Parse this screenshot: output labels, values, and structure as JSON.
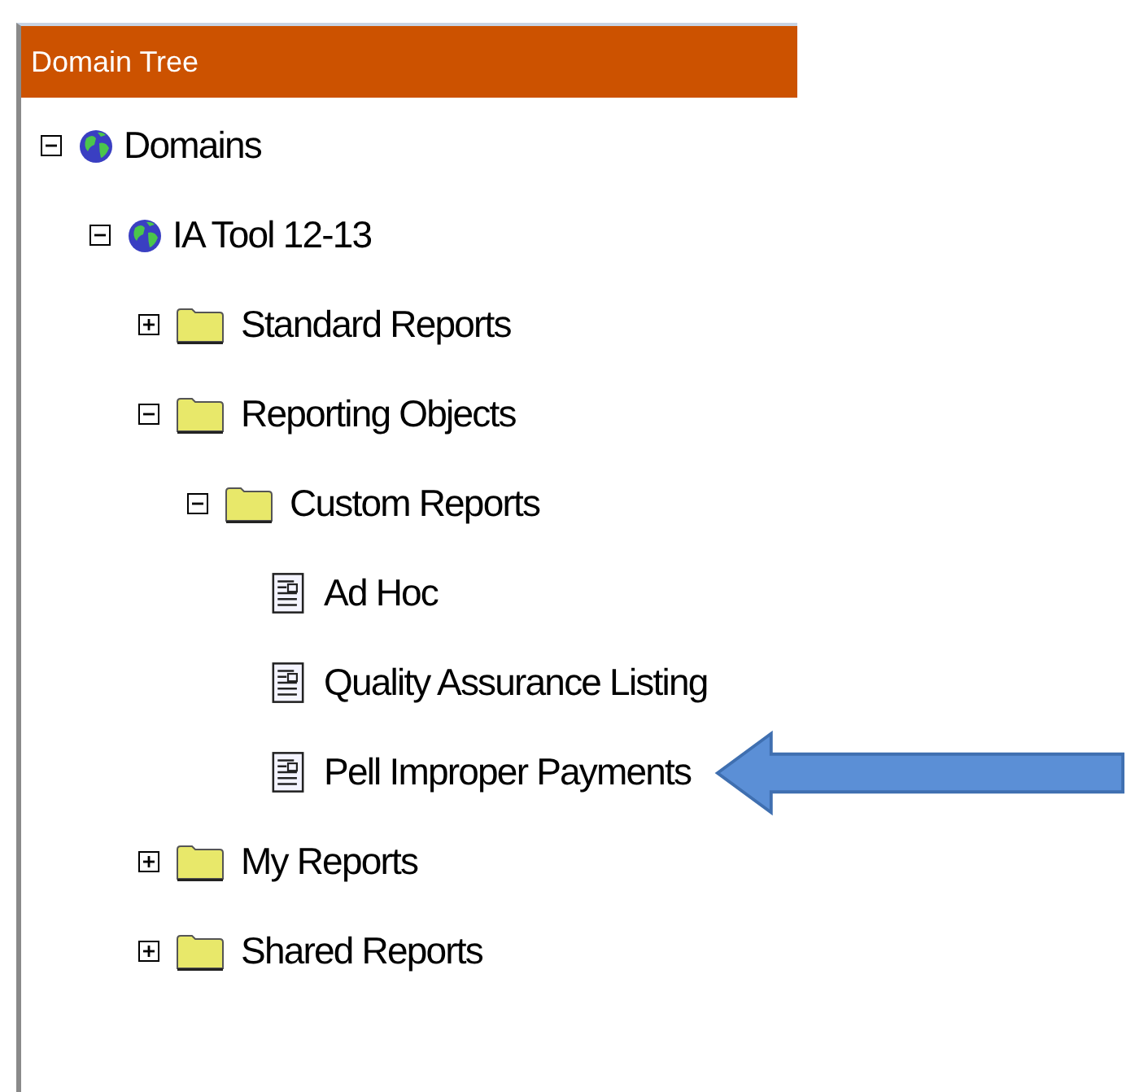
{
  "panel": {
    "title": "Domain Tree"
  },
  "tree": [
    {
      "label": "Domains",
      "kind": "domain",
      "expanded": true,
      "children": [
        {
          "label": "IA Tool 12-13",
          "kind": "domain",
          "expanded": true,
          "children": [
            {
              "label": "Standard Reports",
              "kind": "folder",
              "expanded": false
            },
            {
              "label": "Reporting Objects",
              "kind": "folder",
              "expanded": true,
              "children": [
                {
                  "label": "Custom Reports",
                  "kind": "folder",
                  "expanded": true,
                  "children": [
                    {
                      "label": "Ad Hoc",
                      "kind": "report",
                      "pointed": false
                    },
                    {
                      "label": "Quality Assurance Listing",
                      "kind": "report",
                      "pointed": false
                    },
                    {
                      "label": "Pell Improper Payments",
                      "kind": "report",
                      "pointed": true
                    }
                  ]
                }
              ]
            },
            {
              "label": "My Reports",
              "kind": "folder",
              "expanded": false
            },
            {
              "label": "Shared Reports",
              "kind": "folder",
              "expanded": false
            }
          ]
        }
      ]
    }
  ]
}
